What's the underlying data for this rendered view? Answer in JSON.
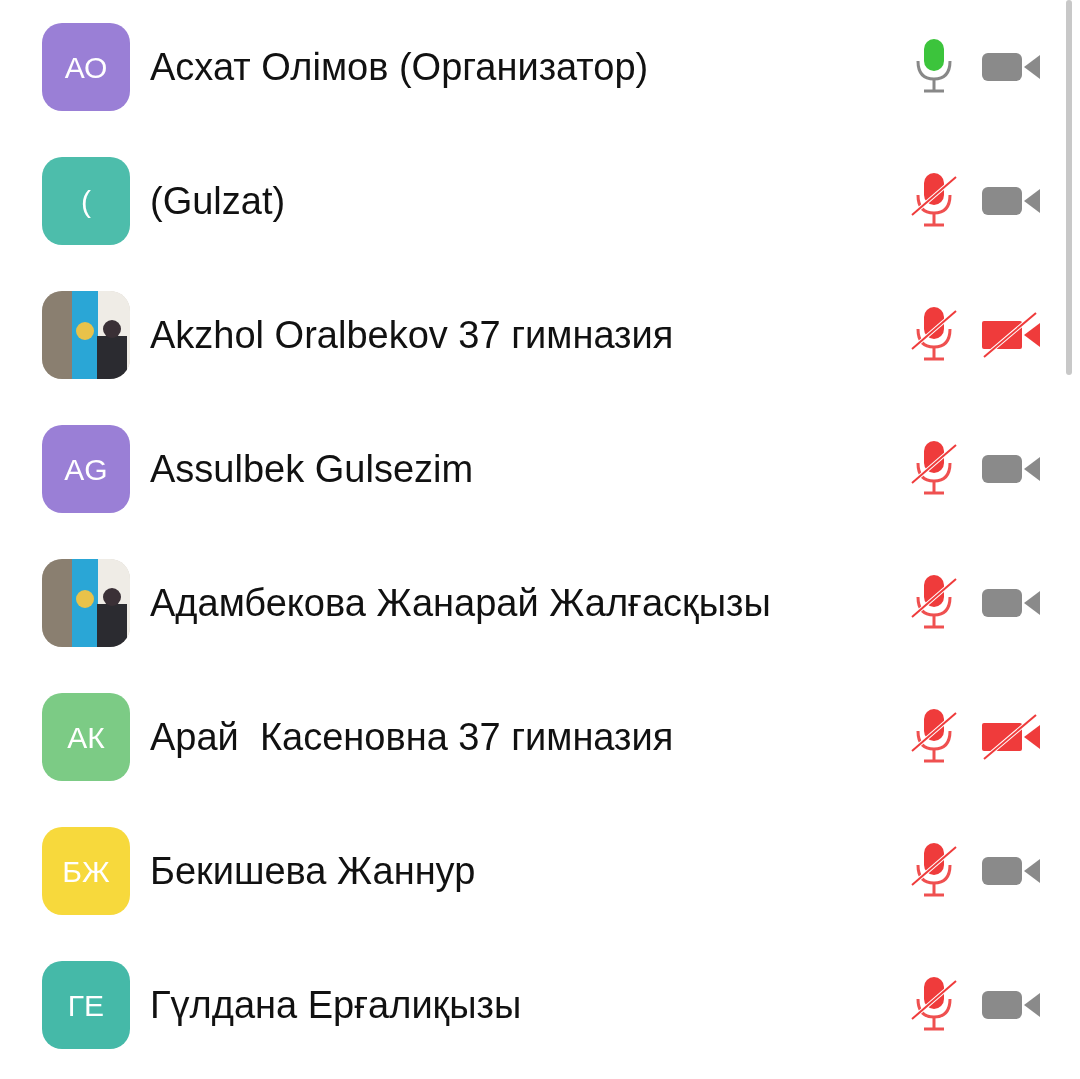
{
  "participants": [
    {
      "name": "Асхат Олімов (Организатор)",
      "avatar": {
        "kind": "initials",
        "text": "АО",
        "color": "#9a7fd6"
      },
      "muted": false,
      "video_off": false
    },
    {
      "name": "(Gulzat)",
      "avatar": {
        "kind": "initials",
        "text": "(",
        "color": "#4dbdab"
      },
      "muted": true,
      "video_off": false
    },
    {
      "name": "Akzhol Oralbekov 37 гимназия",
      "muted": true,
      "video_off": true
    },
    {
      "name": "Assulbek Gulsezim",
      "avatar": {
        "kind": "initials",
        "text": "AG",
        "color": "#9a7fd6"
      },
      "muted": true,
      "video_off": false
    },
    {
      "name": "Адамбекова Жанарай Жалғасқызы",
      "muted": true,
      "video_off": false
    },
    {
      "name": "Арай  Касеновна 37 гимназия",
      "avatar": {
        "kind": "initials",
        "text": "АК",
        "color": "#7ccb85"
      },
      "muted": true,
      "video_off": true
    },
    {
      "name": "Бекишева Жаннур",
      "avatar": {
        "kind": "initials",
        "text": "БЖ",
        "color": "#f7d93c"
      },
      "muted": true,
      "video_off": false
    },
    {
      "name": "Гүлдана Ерғалиқызы",
      "avatar": {
        "kind": "initials",
        "text": "ГЕ",
        "color": "#45b9a8"
      },
      "muted": true,
      "video_off": false
    }
  ]
}
